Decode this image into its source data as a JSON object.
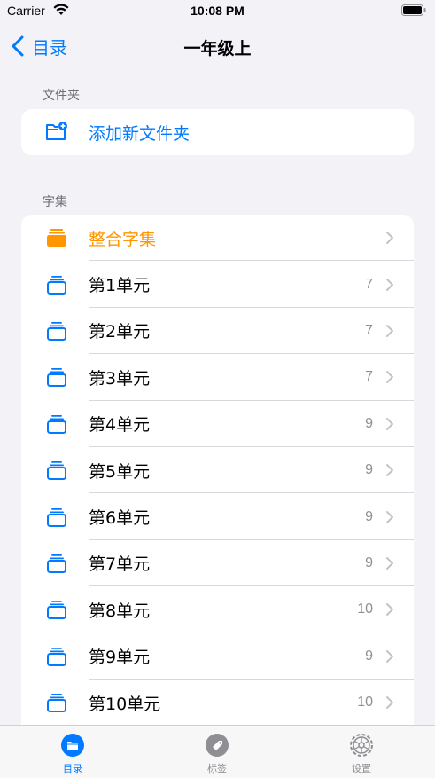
{
  "status_bar": {
    "carrier": "Carrier",
    "time": "10:08 PM"
  },
  "nav": {
    "back_label": "目录",
    "title": "一年级上"
  },
  "folders_section": {
    "header": "文件夹",
    "add_folder_label": "添加新文件夹"
  },
  "sets_section": {
    "header": "字集",
    "merged_label": "整合字集",
    "items": [
      {
        "label": "第1单元",
        "count": "7"
      },
      {
        "label": "第2单元",
        "count": "7"
      },
      {
        "label": "第3单元",
        "count": "7"
      },
      {
        "label": "第4单元",
        "count": "9"
      },
      {
        "label": "第5单元",
        "count": "9"
      },
      {
        "label": "第6单元",
        "count": "9"
      },
      {
        "label": "第7单元",
        "count": "9"
      },
      {
        "label": "第8单元",
        "count": "10"
      },
      {
        "label": "第9单元",
        "count": "9"
      },
      {
        "label": "第10单元",
        "count": "10"
      }
    ]
  },
  "tab_bar": {
    "tabs": [
      {
        "label": "目录",
        "icon": "folder-icon",
        "active": true
      },
      {
        "label": "标签",
        "icon": "tag-icon",
        "active": false
      },
      {
        "label": "设置",
        "icon": "gear-icon",
        "active": false
      }
    ]
  },
  "colors": {
    "accent": "#007aff",
    "orange": "#ff9500",
    "background": "#f2f2f7"
  }
}
